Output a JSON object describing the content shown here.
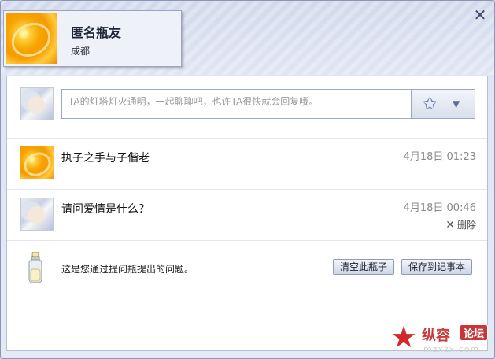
{
  "window": {
    "close_icon": "close-icon"
  },
  "profile": {
    "name": "匿名瓶友",
    "city": "成都",
    "avatar": "rose-avatar"
  },
  "composer": {
    "placeholder": "TA的灯塔灯火通明，一起聊聊吧，也许TA很快就会回复哦。",
    "send_icon": "magic-star-icon",
    "dropdown_icon": "chevron-down-icon"
  },
  "messages": [
    {
      "avatar": "rose-avatar",
      "text": "执子之手与子偕老",
      "time": "4月18日 01:23"
    },
    {
      "avatar": "anime-avatar",
      "text": "请问爱情是什么？",
      "time": "4月18日 00:46",
      "delete_label": "删除"
    }
  ],
  "footer": {
    "icon": "bottle-icon",
    "note": "这是您通过提问瓶提出的问题。",
    "clear_button": "清空此瓶子",
    "save_button": "保存到记事本"
  },
  "watermark": {
    "title": "纵容",
    "badge": "论坛",
    "url": "mzxzx.com"
  }
}
